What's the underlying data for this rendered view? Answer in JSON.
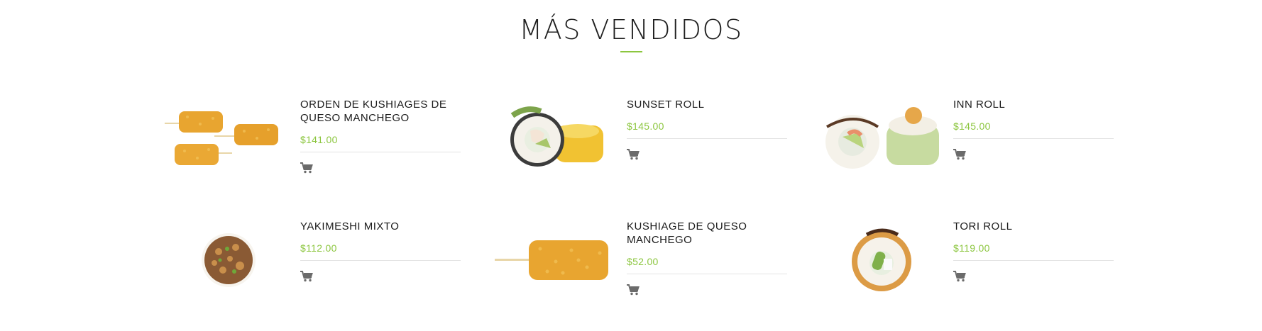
{
  "section": {
    "title": "MÁS VENDIDOS"
  },
  "colors": {
    "accent": "#8cc63f",
    "cart_icon": "#6b6b6b",
    "divider": "#e3e3e3"
  },
  "products": [
    {
      "name": "ORDEN DE KUSHIAGES DE QUESO MANCHEGO",
      "price": "$141.00",
      "image": "kushiages-three-sticks",
      "icon": "cart-icon"
    },
    {
      "name": "SUNSET ROLL",
      "price": "$145.00",
      "image": "sunset-roll",
      "icon": "cart-icon"
    },
    {
      "name": "INN ROLL",
      "price": "$145.00",
      "image": "inn-roll",
      "icon": "cart-icon"
    },
    {
      "name": "YAKIMESHI MIXTO",
      "price": "$112.00",
      "image": "yakimeshi-bowl",
      "icon": "cart-icon"
    },
    {
      "name": "KUSHIAGE DE QUESO MANCHEGO",
      "price": "$52.00",
      "image": "kushiage-single-stick",
      "icon": "cart-icon"
    },
    {
      "name": "TORI ROLL",
      "price": "$119.00",
      "image": "tori-roll",
      "icon": "cart-icon"
    }
  ]
}
